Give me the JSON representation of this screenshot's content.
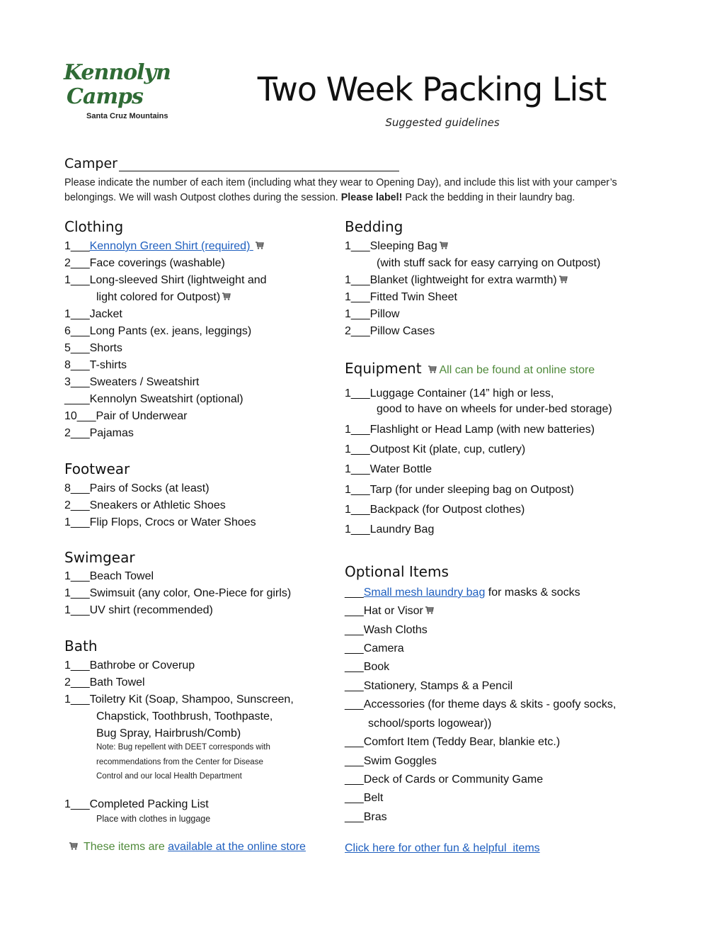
{
  "logo": {
    "line1": "Kennolyn",
    "line2": "Camps",
    "tagline": "Santa Cruz Mountains"
  },
  "header": {
    "title": "Two Week Packing List",
    "subtitle": "Suggested guidelines"
  },
  "camper": {
    "label": "Camper",
    "value": ""
  },
  "intro": {
    "text1": "Please indicate the number of each item (including what they wear to Opening Day), and include this list with your camper’s belongings. We will wash Outpost clothes during the session. ",
    "bold": "Please label!",
    "text2": " Pack the bedding in their laundry bag."
  },
  "clothing": {
    "heading": "Clothing",
    "items": [
      {
        "qty": "1",
        "blank": "___",
        "label": "Kennolyn Green Shirt (required) ",
        "link": true,
        "cart": true
      },
      {
        "qty": "2",
        "blank": "___",
        "label": "Face coverings (washable)"
      },
      {
        "qty": "1",
        "blank": "___",
        "label": "Long-sleeved Shirt (lightweight and",
        "cont": "light colored for Outpost)",
        "cart": true
      },
      {
        "qty": "1",
        "blank": "___",
        "label": "Jacket"
      },
      {
        "qty": "6",
        "blank": "___",
        "label": "Long Pants (ex. jeans, leggings)"
      },
      {
        "qty": "5",
        "blank": "___",
        "label": "Shorts"
      },
      {
        "qty": "8",
        "blank": "___",
        "label": "T-shirts"
      },
      {
        "qty": "3",
        "blank": "___",
        "label": "Sweaters / Sweatshirt"
      },
      {
        "qty": "",
        "blank": "____",
        "label": "Kennolyn Sweatshirt (optional)"
      },
      {
        "qty": "10",
        "blank": "___",
        "label": "Pair of Underwear"
      },
      {
        "qty": "2",
        "blank": "___",
        "label": "Pajamas"
      }
    ]
  },
  "footwear": {
    "heading": "Footwear",
    "items": [
      {
        "qty": "8",
        "blank": "___",
        "label": "Pairs of Socks (at least)"
      },
      {
        "qty": "2",
        "blank": "___",
        "label": "Sneakers or Athletic Shoes"
      },
      {
        "qty": "1",
        "blank": "___",
        "label": "Flip Flops, Crocs or Water Shoes"
      }
    ]
  },
  "swimgear": {
    "heading": "Swimgear",
    "items": [
      {
        "qty": "1",
        "blank": "___",
        "label": "Beach Towel"
      },
      {
        "qty": "1",
        "blank": "___",
        "label": "Swimsuit (any color, One-Piece for girls)"
      },
      {
        "qty": "1",
        "blank": "___",
        "label": "UV shirt (recommended)"
      }
    ]
  },
  "bath": {
    "heading": "Bath",
    "items": [
      {
        "qty": "1",
        "blank": "___",
        "label": "Bathrobe or Coverup"
      },
      {
        "qty": "2",
        "blank": "___",
        "label": "Bath Towel"
      },
      {
        "qty": "1",
        "blank": "___",
        "label": "Toiletry Kit (Soap, Shampoo, Sunscreen,",
        "cont": [
          "Chapstick, Toothbrush, Toothpaste,",
          "Bug Spray, Hairbrush/Comb)"
        ]
      }
    ],
    "note": [
      "Note: Bug repellent with DEET corresponds with",
      "recommendations from the Center for Disease",
      "Control and our local Health Department"
    ]
  },
  "completed": {
    "qty": "1",
    "blank": "___",
    "label": "Completed Packing List",
    "note": "Place with clothes in luggage"
  },
  "store_note": {
    "text": "These items are ",
    "link": "available at the online store"
  },
  "bedding": {
    "heading": "Bedding",
    "items": [
      {
        "qty": "1",
        "blank": "___",
        "label": "Sleeping Bag",
        "cart": true,
        "cont": "(with stuff sack for easy carrying on Outpost)"
      },
      {
        "qty": "1",
        "blank": "___",
        "label": "Blanket (lightweight for extra warmth)",
        "cart": true
      },
      {
        "qty": "1",
        "blank": "___",
        "label": "Fitted Twin Sheet"
      },
      {
        "qty": "1",
        "blank": "___",
        "label": "Pillow"
      },
      {
        "qty": "2",
        "blank": "___",
        "label": "Pillow Cases"
      }
    ]
  },
  "equipment": {
    "heading": "Equipment",
    "note": "All can be found at online store",
    "items": [
      {
        "qty": "1",
        "blank": "___",
        "label": "Luggage Container (14” high or less,",
        "cont": "good to have on wheels for under-bed storage)"
      },
      {
        "qty": "1",
        "blank": "___",
        "label": "Flashlight or Head Lamp (with new batteries)"
      },
      {
        "qty": "1",
        "blank": "___",
        "label": "Outpost Kit (plate, cup, cutlery)"
      },
      {
        "qty": "1",
        "blank": "___",
        "label": "Water Bottle"
      },
      {
        "qty": "1",
        "blank": "___",
        "label": "Tarp (for under sleeping bag on Outpost)"
      },
      {
        "qty": "1",
        "blank": "___",
        "label": "Backpack (for Outpost clothes)"
      },
      {
        "qty": "1",
        "blank": "___",
        "label": "Laundry Bag"
      }
    ]
  },
  "optional": {
    "heading": "Optional Items",
    "items": [
      {
        "blank": "___",
        "link": "Small mesh laundry bag",
        "label": " for masks & socks"
      },
      {
        "blank": "___",
        "label": "Hat or Visor",
        "cart": true
      },
      {
        "blank": "___",
        "label": "Wash Cloths"
      },
      {
        "blank": "___",
        "label": "Camera"
      },
      {
        "blank": "___",
        "label": "Book"
      },
      {
        "blank": "___",
        "label": "Stationery, Stamps & a Pencil"
      },
      {
        "blank": "___",
        "label": "Accessories (for theme days & skits - goofy socks,",
        "cont": "school/sports logowear))"
      },
      {
        "blank": "___",
        "label": "Comfort Item (Teddy Bear, blankie etc.)"
      },
      {
        "blank": "___",
        "label": "Swim Goggles"
      },
      {
        "blank": "___",
        "label": "Deck of Cards or Community Game"
      },
      {
        "blank": "___",
        "label": "Belt"
      },
      {
        "blank": "___",
        "label": "Bras"
      }
    ]
  },
  "footer_link": "Click here for other fun & helpful  items",
  "colors": {
    "link": "#1f5fbf",
    "green": "#4f8a3a",
    "logo_green": "#2f6b35"
  }
}
